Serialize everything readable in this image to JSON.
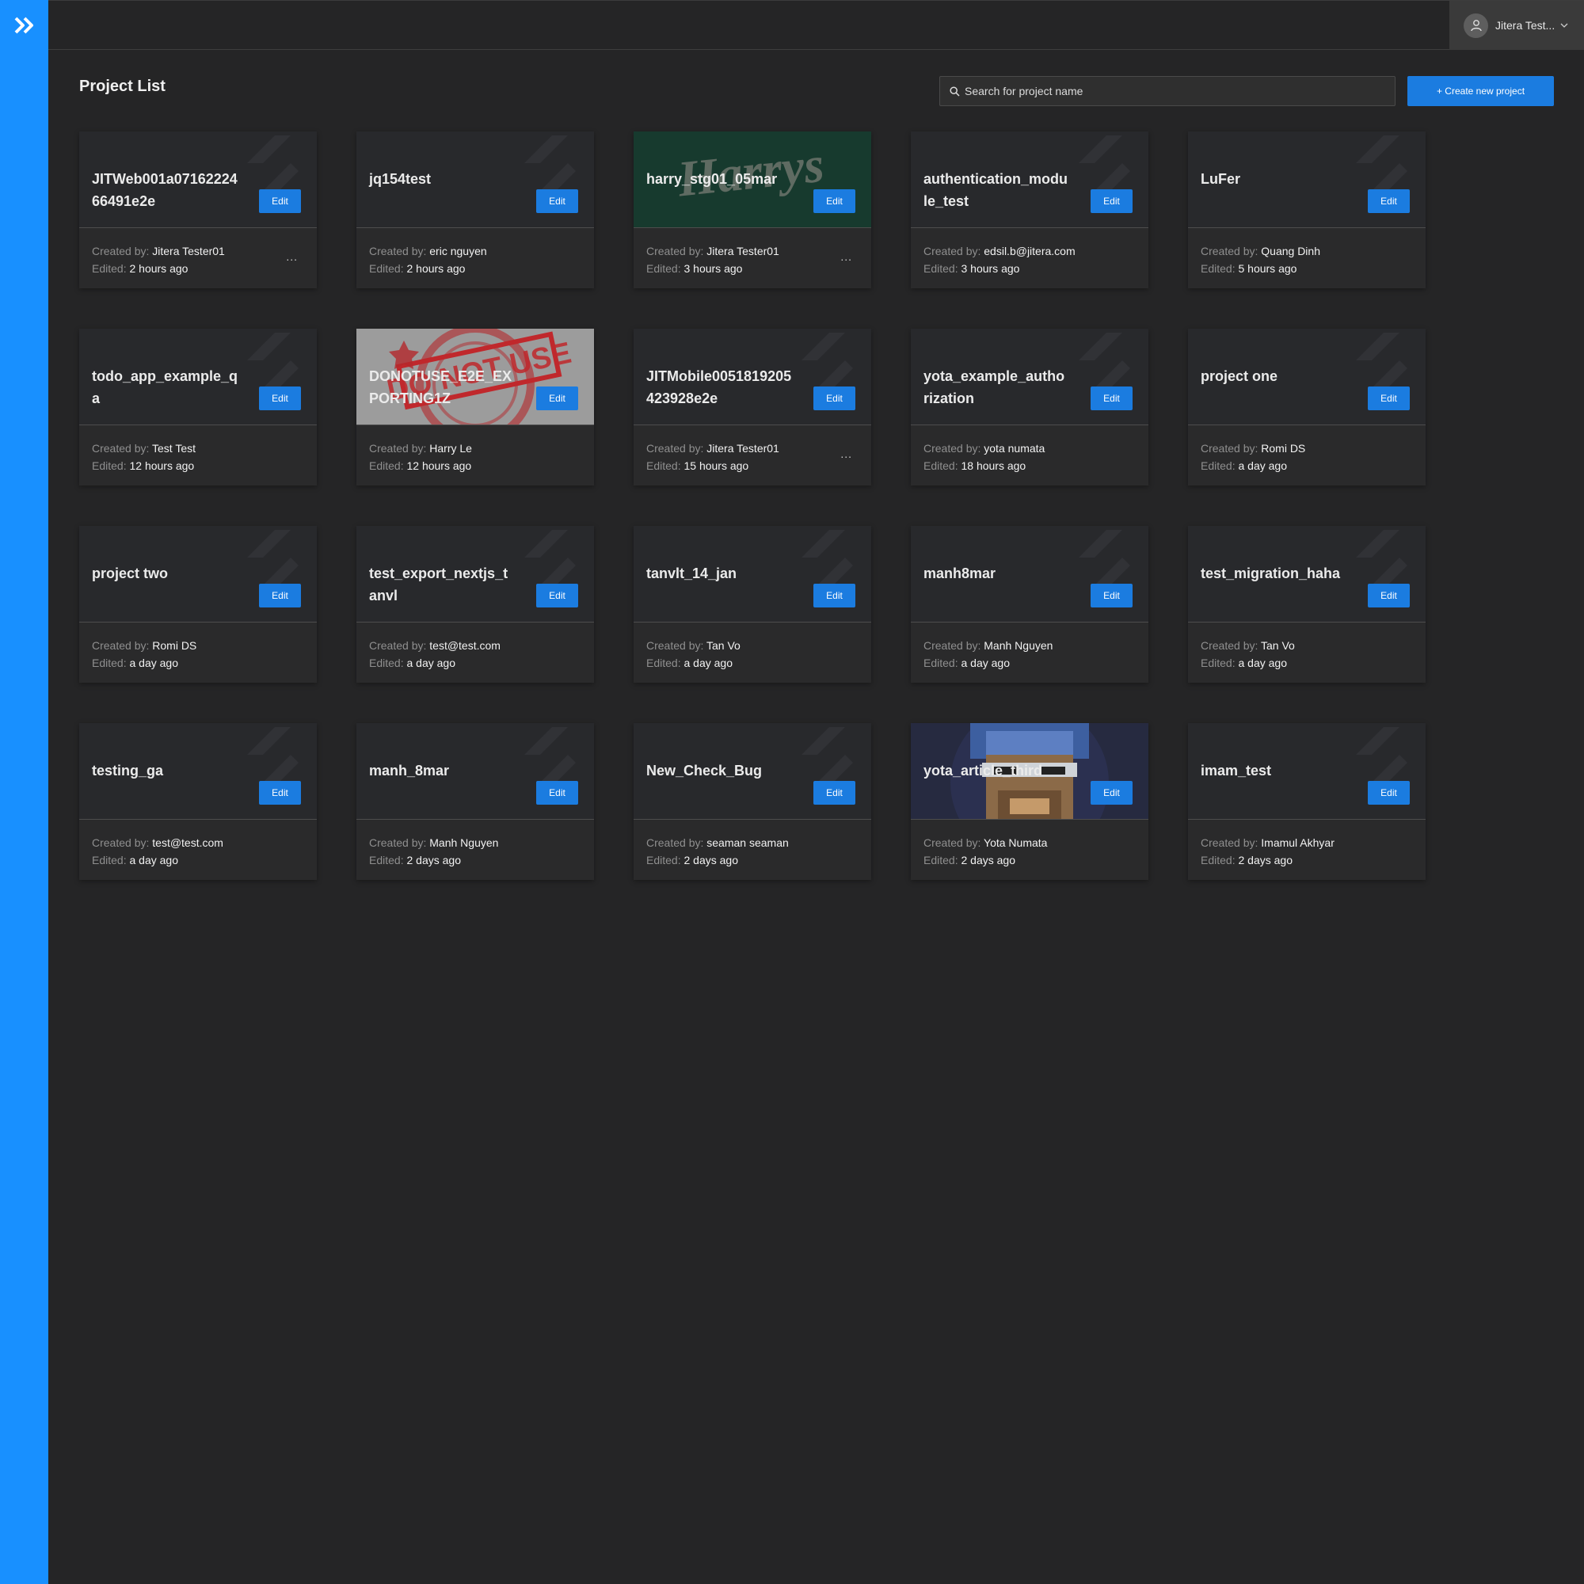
{
  "sidebar": {
    "expand_icon": "double-chevron-right-icon",
    "color": "#1890ff"
  },
  "header": {
    "user_name": "Jitera Test...",
    "avatar_icon": "user-icon",
    "dropdown_icon": "chevron-down-icon"
  },
  "page": {
    "title": "Project List",
    "search_placeholder": "Search for project name",
    "create_label": "+ Create new project"
  },
  "labels": {
    "created_by": "Created by:",
    "edited": "Edited:",
    "edit": "Edit",
    "more": "..."
  },
  "projects": [
    {
      "name": "JITWeb001a0716222466491e2e",
      "created_by": "Jitera Tester01",
      "edited": "2 hours ago",
      "more": true
    },
    {
      "name": "jq154test",
      "created_by": "eric nguyen",
      "edited": "2 hours ago"
    },
    {
      "name": "harry_stg01_05mar",
      "created_by": "Jitera Tester01",
      "edited": "3 hours ago",
      "more": true,
      "thumbnail": "harrys-logo",
      "thumbnail_text": "Harrys"
    },
    {
      "name": "authentication_module_test",
      "created_by": "edsil.b@jitera.com",
      "edited": "3 hours ago"
    },
    {
      "name": "LuFer",
      "created_by": "Quang Dinh",
      "edited": "5 hours ago"
    },
    {
      "name": "todo_app_example_qa",
      "created_by": "Test Test",
      "edited": "12 hours ago"
    },
    {
      "name": "DONOTUSE_E2E_EXPORTING1Z",
      "created_by": "Harry Le",
      "edited": "12 hours ago",
      "thumbnail": "do-not-use-stamp",
      "thumbnail_text": "DO NOT USE"
    },
    {
      "name": "JITMobile0051819205423928e2e",
      "created_by": "Jitera Tester01",
      "edited": "15 hours ago",
      "more": true
    },
    {
      "name": "yota_example_authorization",
      "created_by": "yota numata",
      "edited": "18 hours ago"
    },
    {
      "name": "project one",
      "created_by": "Romi DS",
      "edited": "a day ago"
    },
    {
      "name": "project two",
      "created_by": "Romi DS",
      "edited": "a day ago"
    },
    {
      "name": "test_export_nextjs_tanvl",
      "created_by": "test@test.com",
      "edited": "a day ago"
    },
    {
      "name": "tanvlt_14_jan",
      "created_by": "Tan Vo",
      "edited": "a day ago"
    },
    {
      "name": "manh8mar",
      "created_by": "Manh Nguyen",
      "edited": "a day ago"
    },
    {
      "name": "test_migration_haha",
      "created_by": "Tan Vo",
      "edited": "a day ago"
    },
    {
      "name": "testing_ga",
      "created_by": "test@test.com",
      "edited": "a day ago"
    },
    {
      "name": "manh_8mar",
      "created_by": "Manh Nguyen",
      "edited": "2 days ago"
    },
    {
      "name": "New_Check_Bug",
      "created_by": "seaman seaman",
      "edited": "2 days ago"
    },
    {
      "name": "yota_article_third",
      "created_by": "Yota Numata",
      "edited": "2 days ago",
      "thumbnail": "pixel-avatar"
    },
    {
      "name": "imam_test",
      "created_by": "Imamul Akhyar",
      "edited": "2 days ago"
    }
  ]
}
